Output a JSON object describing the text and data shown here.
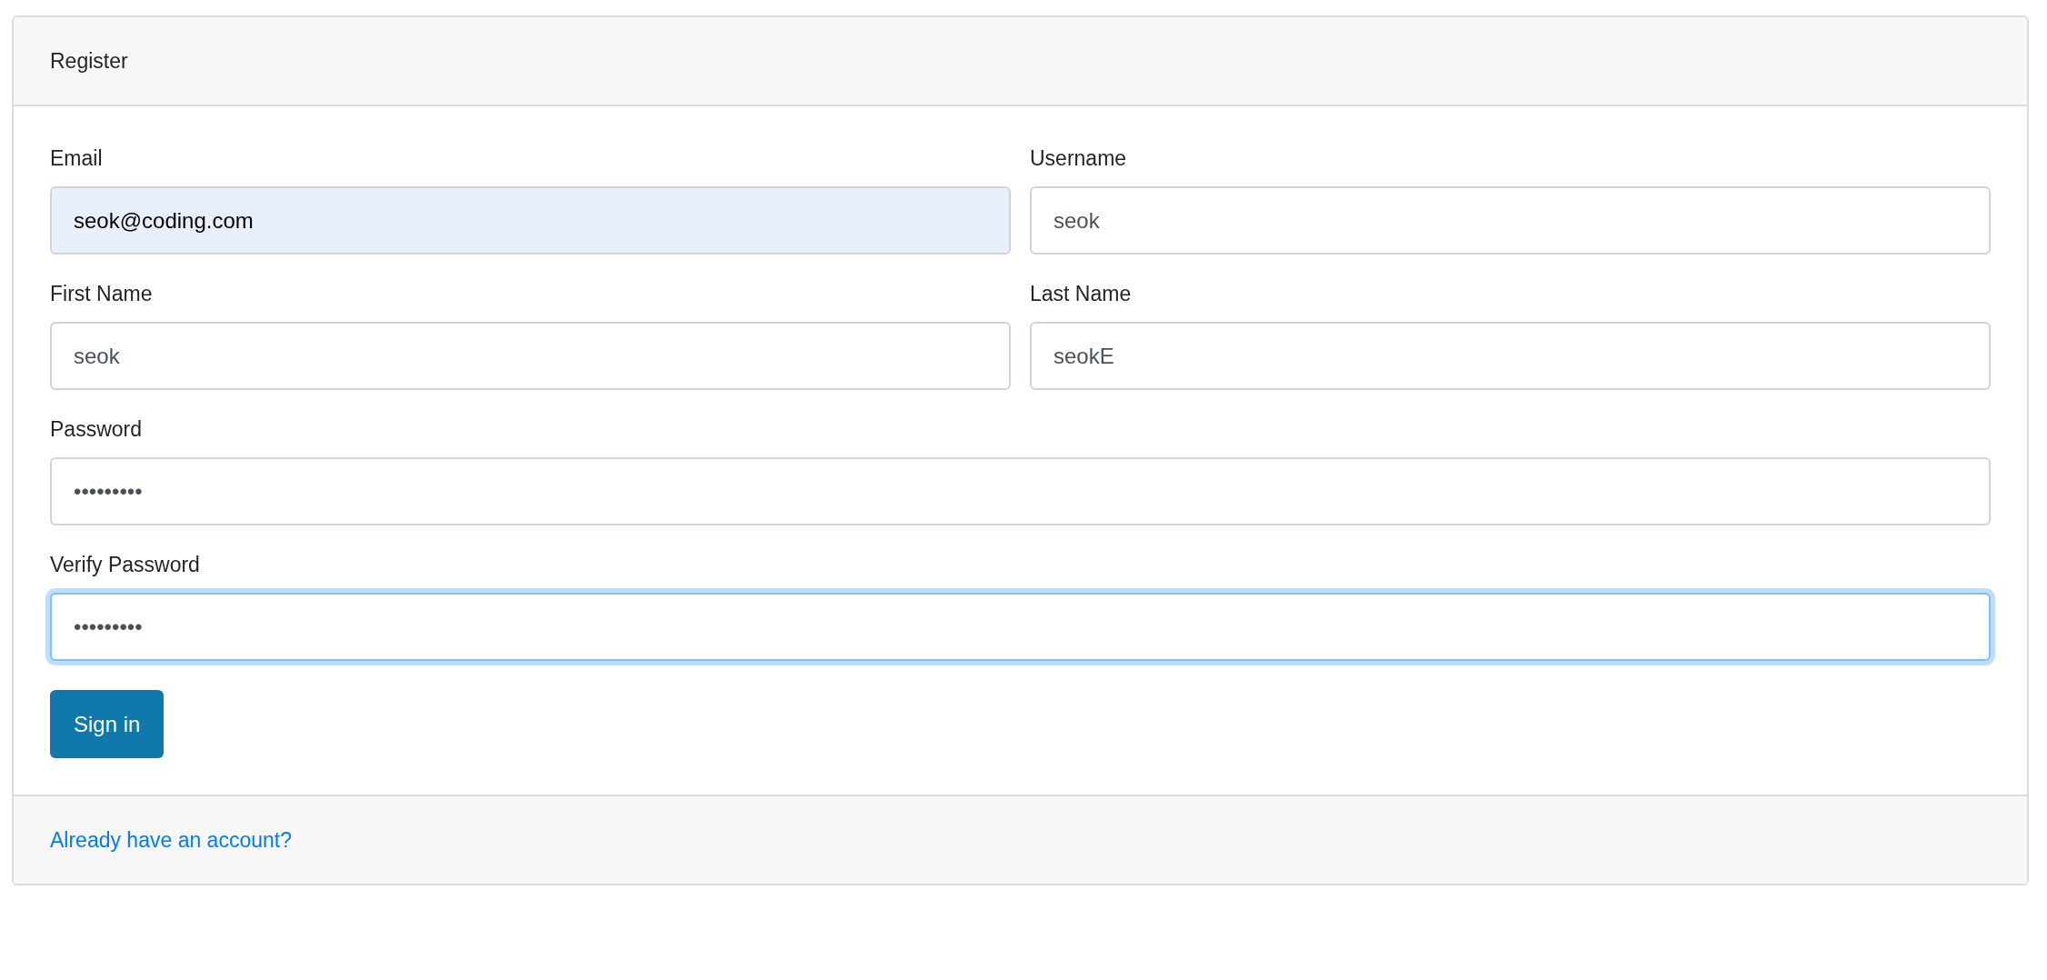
{
  "card": {
    "title": "Register"
  },
  "fields": [
    {
      "label": "Email",
      "value": "seok@coding.com",
      "kind": "half",
      "autofilled": true,
      "focused": false
    },
    {
      "label": "Username",
      "value": "seok",
      "kind": "half",
      "autofilled": false,
      "focused": false
    },
    {
      "label": "First Name",
      "value": "seok",
      "kind": "half",
      "autofilled": false,
      "focused": false
    },
    {
      "label": "Last Name",
      "value": "seokE",
      "kind": "half",
      "autofilled": false,
      "focused": false
    },
    {
      "label": "Password",
      "value": "•••••••••",
      "kind": "full",
      "autofilled": false,
      "focused": false
    },
    {
      "label": "Verify Password",
      "value": "•••••••••",
      "kind": "full",
      "autofilled": false,
      "focused": true
    }
  ],
  "submit_button": "Sign in",
  "footer": {
    "link": "Already have an account?"
  }
}
